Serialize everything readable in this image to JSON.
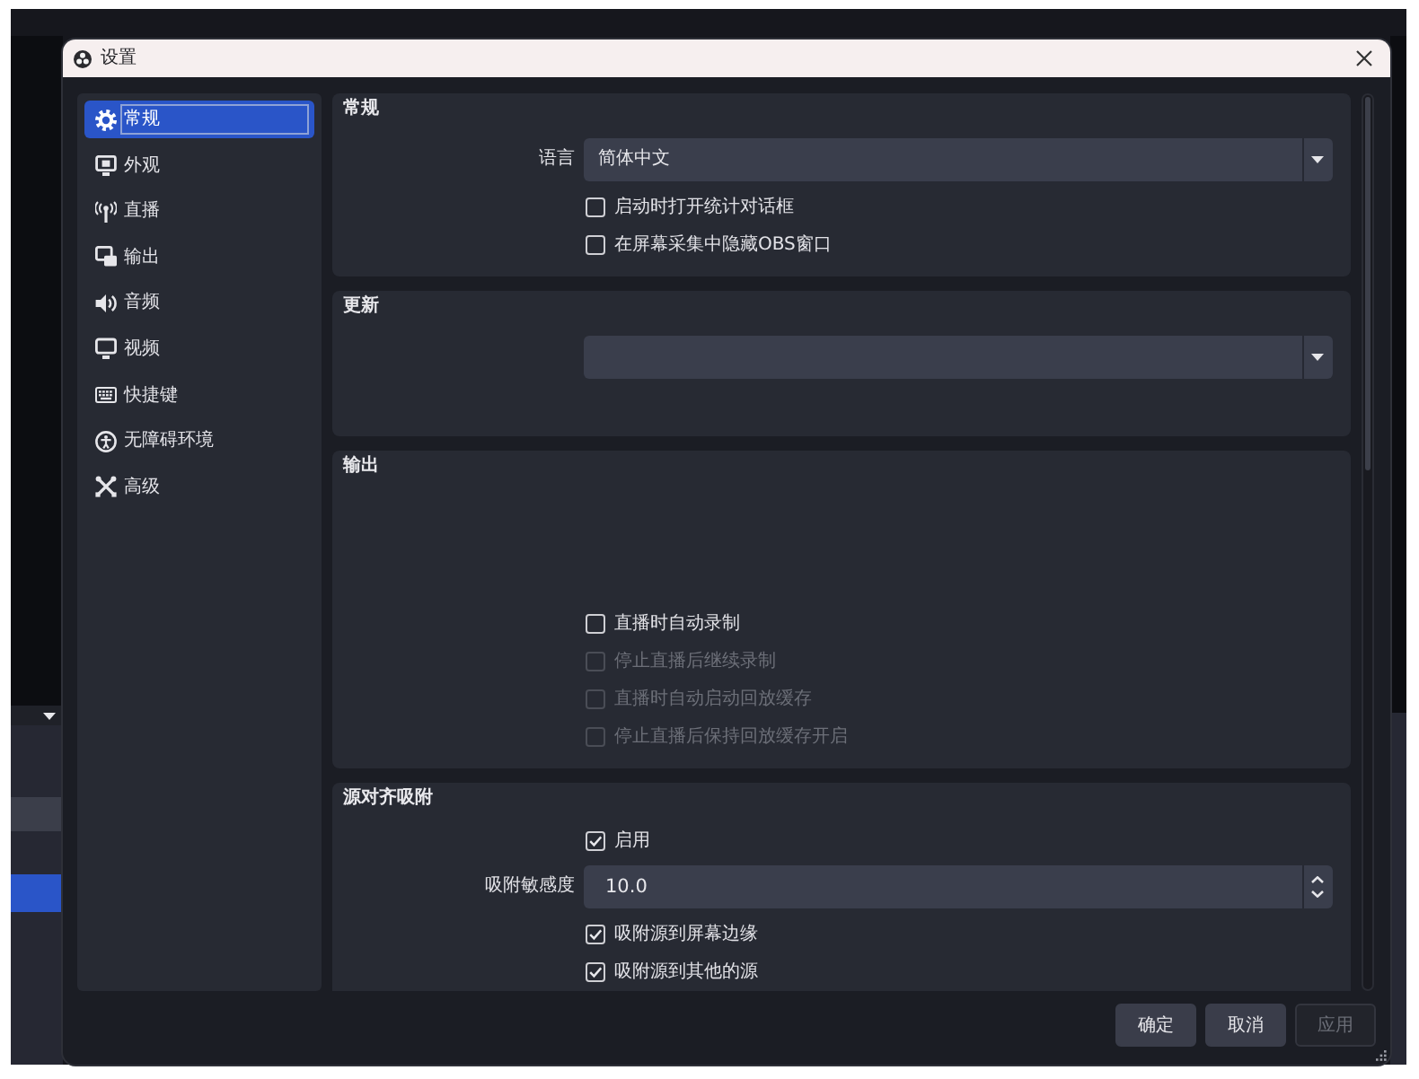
{
  "window": {
    "title": "设置"
  },
  "sidebar": {
    "items": [
      {
        "label": "常规",
        "selected": true
      },
      {
        "label": "外观",
        "selected": false
      },
      {
        "label": "直播",
        "selected": false
      },
      {
        "label": "输出",
        "selected": false
      },
      {
        "label": "音频",
        "selected": false
      },
      {
        "label": "视频",
        "selected": false
      },
      {
        "label": "快捷键",
        "selected": false
      },
      {
        "label": "无障碍环境",
        "selected": false
      },
      {
        "label": "高级",
        "selected": false
      }
    ]
  },
  "sections": [
    {
      "title": "常规",
      "rows": [
        {
          "kind": "dropdown",
          "label": "语言",
          "value": "简体中文",
          "disabled": false
        },
        {
          "kind": "checkbox",
          "label": "启动时打开统计对话框",
          "checked": false,
          "disabled": false
        },
        {
          "kind": "checkbox",
          "label": "在屏幕采集中隐藏OBS窗口",
          "checked": false,
          "disabled": false
        }
      ]
    },
    {
      "title": "更新",
      "rows": [
        {
          "kind": "dropdown",
          "disabled": false
        }
      ]
    },
    {
      "title": "输出",
      "rows": [
        {
          "kind": "checkbox",
          "label": "直播时自动录制",
          "checked": false,
          "disabled": false
        },
        {
          "kind": "checkbox",
          "label": "停止直播后继续录制",
          "checked": false,
          "disabled": true
        },
        {
          "kind": "checkbox",
          "label": "直播时自动启动回放缓存",
          "checked": false,
          "disabled": true
        },
        {
          "kind": "checkbox",
          "label": "停止直播后保持回放缓存开启",
          "checked": false,
          "disabled": true
        }
      ]
    },
    {
      "title": "源对齐吸附",
      "rows": [
        {
          "kind": "checkbox",
          "label": "启用",
          "checked": true,
          "disabled": false
        },
        {
          "kind": "spinbox",
          "label": "吸附敏感度",
          "value": "10.0",
          "disabled": false
        },
        {
          "kind": "checkbox",
          "label": "吸附源到屏幕边缘",
          "checked": true,
          "disabled": false
        },
        {
          "kind": "checkbox",
          "label": "吸附源到其他的源",
          "checked": true,
          "disabled": false
        }
      ]
    }
  ],
  "buttons": [
    {
      "label": "确定",
      "disabled": false
    },
    {
      "label": "取消",
      "disabled": false
    },
    {
      "label": "应用",
      "disabled": true
    }
  ]
}
